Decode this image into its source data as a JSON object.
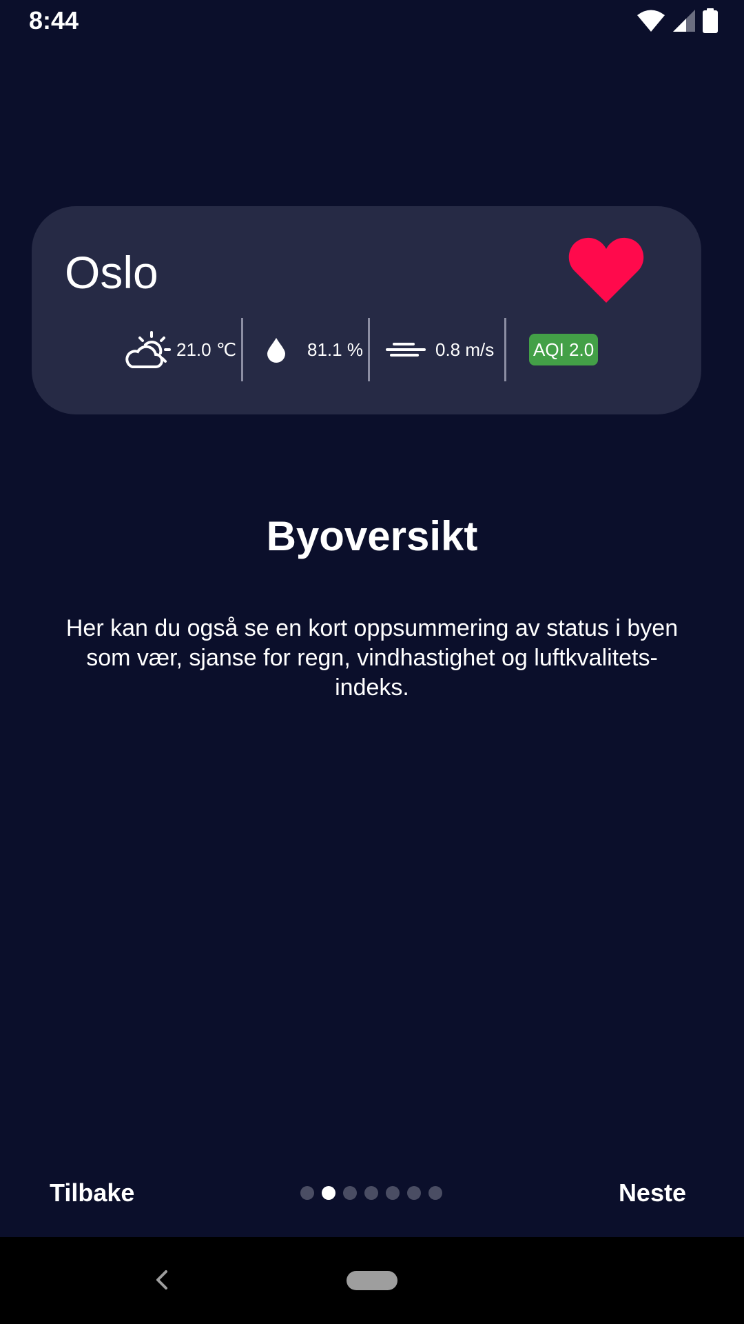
{
  "status_bar": {
    "time": "8:44",
    "icons": [
      "wifi-icon",
      "cellular-signal-icon",
      "battery-icon"
    ]
  },
  "city_card": {
    "city_name": "Oslo",
    "favorite_icon": "heart-icon",
    "favorite_color": "#ff0a4c",
    "temperature": "21.0 ℃",
    "weather_icon": "partly-cloudy-icon",
    "humidity": "81.1 %",
    "humidity_icon": "water-drop-icon",
    "wind_speed": "0.8 m/s",
    "wind_icon": "wind-icon",
    "aqi": "AQI 2.0",
    "aqi_color": "#43a047"
  },
  "onboarding": {
    "title": "Byoversikt",
    "description": "Her kan du også se en kort oppsummering av status i byen som vær, sjanse for regn, vindhastighet og luftkvalitets-indeks."
  },
  "navigation": {
    "back_label": "Tilbake",
    "next_label": "Neste",
    "page_count": 7,
    "current_page": 2
  }
}
